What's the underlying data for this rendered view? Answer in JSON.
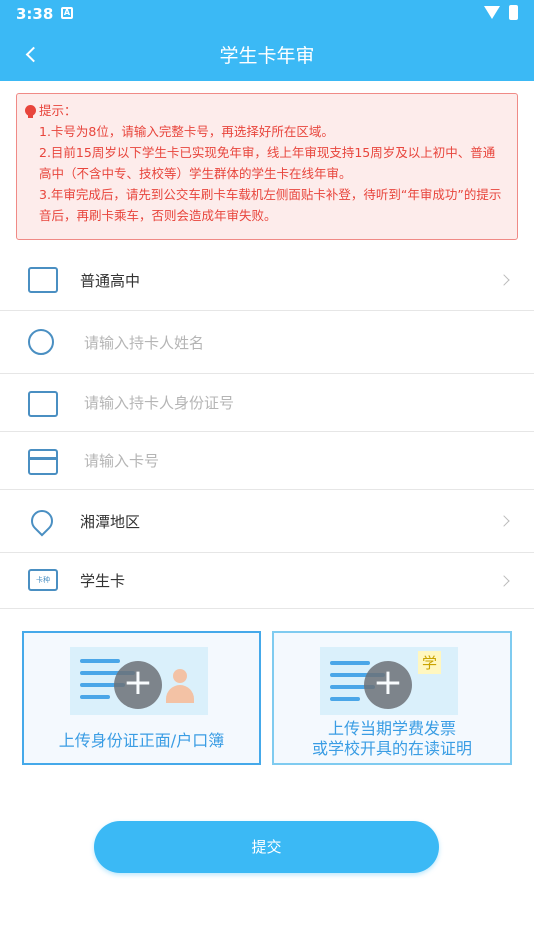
{
  "status_bar": {
    "time": "3:38",
    "notif_icon": "A"
  },
  "nav": {
    "title": "学生卡年审"
  },
  "notice": {
    "heading": "提示：",
    "lines": [
      "1.卡号为8位，请输入完整卡号，再选择好所在区域。",
      "2.目前15周岁以下学生卡已实现免年审，线上年审现支持15周岁及以上初中、普通高中（不含中专、技校等）学生群体的学生卡在线年审。",
      "3.年审完成后，请先到公交车刷卡车载机左侧面贴卡补登，待听到“年审成功”的提示音后，再刷卡乘车，否则会造成年审失败。"
    ]
  },
  "form": {
    "school_type": "普通高中",
    "name_placeholder": "请输入持卡人姓名",
    "id_placeholder": "请输入持卡人身份证号",
    "card_placeholder": "请输入卡号",
    "region": "湘潭地区",
    "card_type": "学生卡"
  },
  "stucard_icon_text": "卡种",
  "uploads": {
    "left_caption": "上传身份证正面/户口簿",
    "right_caption_1": "上传当期学费发票",
    "right_caption_2": "或学校开具的在读证明",
    "right_stamp": "学"
  },
  "submit_label": "提交"
}
